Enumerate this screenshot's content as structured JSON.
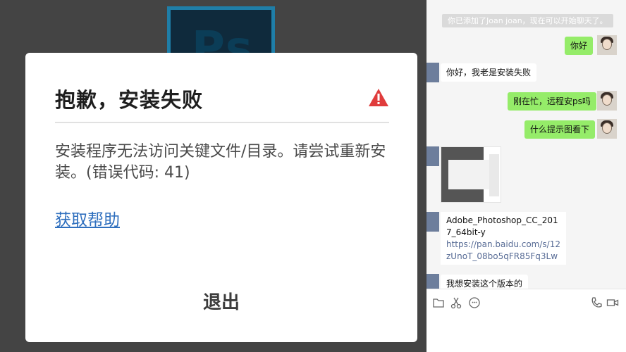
{
  "installer": {
    "logo_text": "Ps",
    "dialog": {
      "title": "抱歉，安装失败",
      "message": "安装程序无法访问关键文件/目录。请尝试重新安装。(错误代码: 41)",
      "help_link": "获取帮助",
      "quit_label": "退出"
    },
    "warning_color": "#e03c3c",
    "link_color": "#2f6fbe"
  },
  "chat": {
    "system_note": "你已添加了Joan joan，现在可以开始聊天了。",
    "messages": [
      {
        "side": "out",
        "text": "你好"
      },
      {
        "side": "in",
        "text": "你好，我老是安装失败"
      },
      {
        "side": "out",
        "text": "刚在忙，远程安ps吗"
      },
      {
        "side": "out",
        "text": "什么提示图看下"
      },
      {
        "side": "in",
        "type": "image"
      },
      {
        "side": "in",
        "type": "file",
        "name": "Adobe_Photoshop_CC_2017_64bit-y",
        "link": "https://pan.baidu.com/s/12zUnoT_08bo5qFR85Fq3Lw"
      },
      {
        "side": "in",
        "text": "我想安装这个版本的"
      }
    ],
    "toolbar": [
      "folder-icon",
      "scissors-icon",
      "emoji-icon",
      "phone-icon",
      "video-icon"
    ],
    "bubble_color": "#95ec69"
  }
}
